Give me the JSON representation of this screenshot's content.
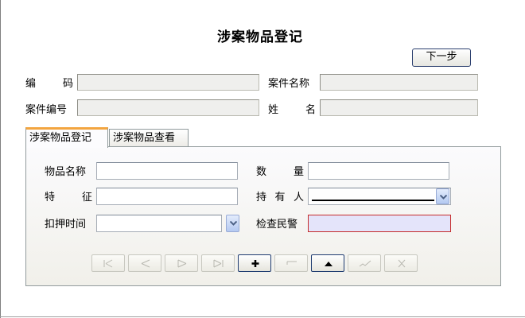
{
  "window": {
    "title": "涉案物品登记"
  },
  "toolbar": {
    "next_label": "下一步"
  },
  "case_info": {
    "code_label": [
      "编",
      "码"
    ],
    "case_name_label": "案件名称",
    "case_no_label": "案件编号",
    "name_label": [
      "姓",
      "名"
    ],
    "code_value": "",
    "case_name_value": "",
    "case_no_value": "",
    "name_value": ""
  },
  "tabs": [
    {
      "label": "涉案物品登记",
      "active": true
    },
    {
      "label": "涉案物品查看",
      "active": false
    }
  ],
  "form": {
    "item_name_label": "物品名称",
    "quantity_label": [
      "数",
      "量"
    ],
    "feature_label": [
      "特",
      "征"
    ],
    "holder_label": [
      "持",
      "有",
      "人"
    ],
    "seize_time_label": "扣押时间",
    "officer_label": "检查民警",
    "item_name_value": "",
    "quantity_value": "",
    "feature_value": "",
    "holder_value": "",
    "seize_time_value": "",
    "officer_value": ""
  },
  "navigator": {
    "buttons": [
      {
        "icon": "first-record-icon",
        "enabled": false
      },
      {
        "icon": "prior-record-icon",
        "enabled": false
      },
      {
        "icon": "next-record-icon",
        "enabled": false
      },
      {
        "icon": "last-record-icon",
        "enabled": false
      },
      {
        "icon": "insert-record-icon",
        "enabled": true
      },
      {
        "icon": "delete-record-icon",
        "enabled": false
      },
      {
        "icon": "edit-record-icon",
        "enabled": true
      },
      {
        "icon": "post-record-icon",
        "enabled": false
      },
      {
        "icon": "cancel-record-icon",
        "enabled": false
      }
    ]
  },
  "colors": {
    "tab_accent": "#f3a53f",
    "required_border": "#c52b2b",
    "required_fill": "#e4e4fa"
  }
}
